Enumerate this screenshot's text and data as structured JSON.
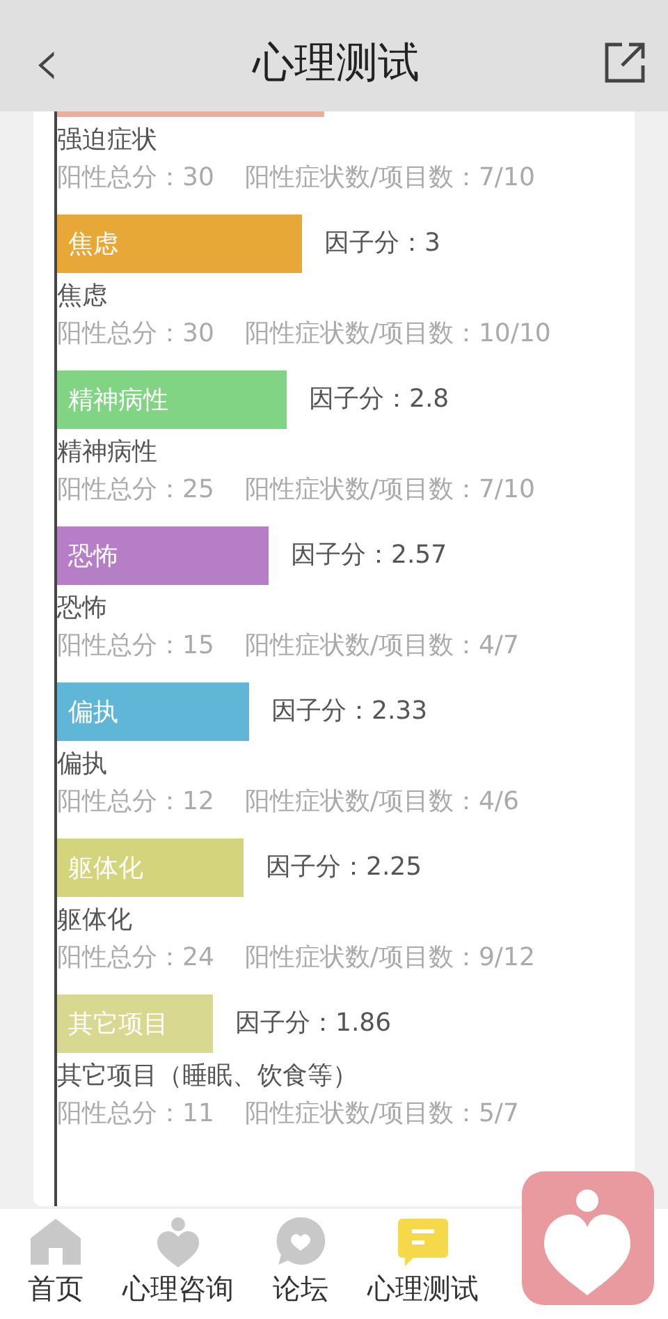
{
  "header": {
    "back": "‹",
    "title": "心理测试"
  },
  "items": [
    {
      "color": "#e8b09c",
      "name": "强迫症状",
      "total": "阳性总分：30",
      "ratio": "阳性症状数/项目数：7/10"
    },
    {
      "bar_label": "焦虑",
      "factor": "因子分：3",
      "color": "#e8a838",
      "name": "焦虑",
      "total": "阳性总分：30",
      "ratio": "阳性症状数/项目数：10/10"
    },
    {
      "bar_label": "精神病性",
      "factor": "因子分：2.8",
      "color": "#80d484",
      "name": "精神病性",
      "total": "阳性总分：25",
      "ratio": "阳性症状数/项目数：7/10"
    },
    {
      "bar_label": "恐怖",
      "factor": "因子分：2.57",
      "color": "#b67ec6",
      "name": "恐怖",
      "total": "阳性总分：15",
      "ratio": "阳性症状数/项目数：4/7"
    },
    {
      "bar_label": "偏执",
      "factor": "因子分：2.33",
      "color": "#5fb6d6",
      "name": "偏执",
      "total": "阳性总分：12",
      "ratio": "阳性症状数/项目数：4/6"
    },
    {
      "bar_label": "躯体化",
      "factor": "因子分：2.25",
      "color": "#d4d47c",
      "name": "躯体化",
      "total": "阳性总分：24",
      "ratio": "阳性症状数/项目数：9/12"
    },
    {
      "bar_label": "其它项目",
      "factor": "因子分：1.86",
      "color": "#d8d890",
      "name": "其它项目（睡眠、饮食等）",
      "total": "阳性总分：11",
      "ratio": "阳性症状数/项目数：5/7"
    }
  ],
  "tabs": [
    {
      "label": "首页",
      "kind": "home",
      "selected": false
    },
    {
      "label": "心理咨询",
      "kind": "consult",
      "selected": false
    },
    {
      "label": "论坛",
      "kind": "forum",
      "selected": false
    },
    {
      "label": "心理测试",
      "kind": "test",
      "selected": true
    }
  ]
}
